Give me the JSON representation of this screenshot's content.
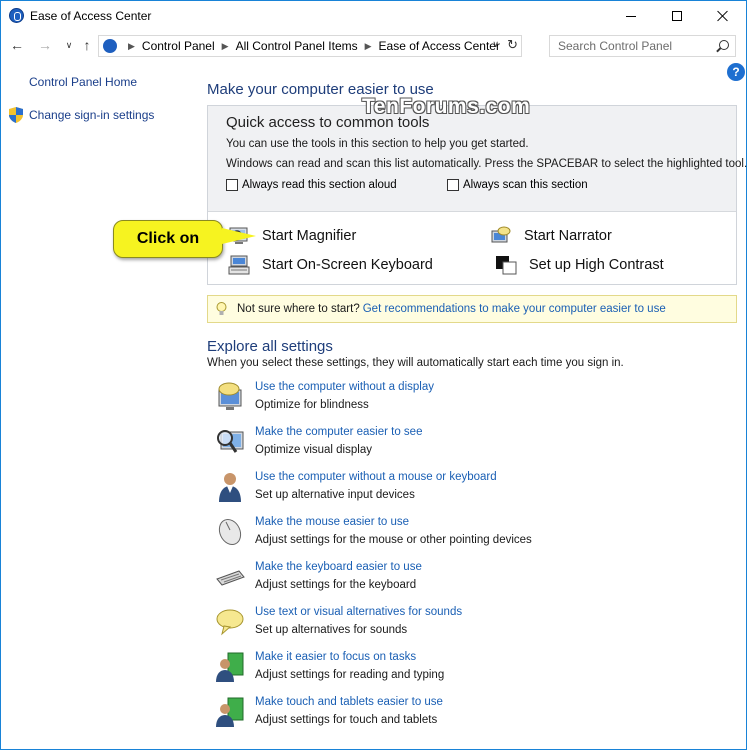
{
  "window": {
    "title": "Ease of Access Center"
  },
  "address": {
    "crumbs": [
      "Control Panel",
      "All Control Panel Items",
      "Ease of Access Center"
    ],
    "search_placeholder": "Search Control Panel"
  },
  "leftnav": {
    "home": "Control Panel Home",
    "signin": "Change sign-in settings"
  },
  "main": {
    "title": "Make your computer easier to use",
    "watermark": "TenForums.com",
    "quick_access": {
      "heading": "Quick access to common tools",
      "line1": "You can use the tools in this section to help you get started.",
      "line2": "Windows can read and scan this list automatically.  Press the SPACEBAR to select the highlighted tool.",
      "checkbox_read": "Always read this section aloud",
      "checkbox_scan": "Always scan this section",
      "tools": {
        "magnifier": "Start Magnifier",
        "narrator": "Start Narrator",
        "keyboard": "Start On-Screen Keyboard",
        "contrast": "Set up High Contrast"
      }
    },
    "callout": "Click on",
    "tip": {
      "text": "Not sure where to start?",
      "link": "Get recommendations to make your computer easier to use"
    },
    "explore": {
      "title": "Explore all settings",
      "subtitle": "When you select these settings, they will automatically start each time you sign in.",
      "items": [
        {
          "link": "Use the computer without a display",
          "desc": "Optimize for blindness",
          "icon": "monitor-speech-icon"
        },
        {
          "link": "Make the computer easier to see",
          "desc": "Optimize visual display",
          "icon": "magnifier-monitor-icon"
        },
        {
          "link": "Use the computer without a mouse or keyboard",
          "desc": "Set up alternative input devices",
          "icon": "person-icon"
        },
        {
          "link": "Make the mouse easier to use",
          "desc": "Adjust settings for the mouse or other pointing devices",
          "icon": "mouse-icon"
        },
        {
          "link": "Make the keyboard easier to use",
          "desc": "Adjust settings for the keyboard",
          "icon": "keyboard-icon"
        },
        {
          "link": "Use text or visual alternatives for sounds",
          "desc": "Set up alternatives for sounds",
          "icon": "speech-bubble-icon"
        },
        {
          "link": "Make it easier to focus on tasks",
          "desc": "Adjust settings for reading and typing",
          "icon": "focus-tasks-icon"
        },
        {
          "link": "Make touch and tablets easier to use",
          "desc": "Adjust settings for touch and tablets",
          "icon": "touch-tablet-icon"
        }
      ]
    }
  },
  "colors": {
    "link": "#1a5fb4",
    "heading": "#1e3d7a",
    "callout": "#f6f320",
    "tip_bg": "#fffde0"
  }
}
